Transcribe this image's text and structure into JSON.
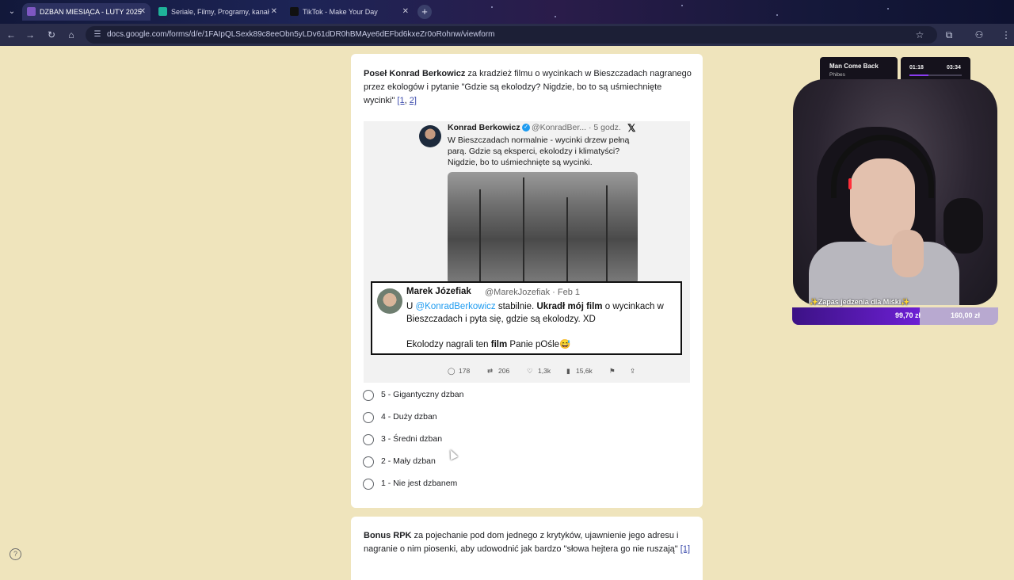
{
  "browser": {
    "tabs": [
      {
        "title": "DZBAN MIESIĄCA - LUTY 2025",
        "active": true
      },
      {
        "title": "Seriale, Filmy, Programy, kanał",
        "active": false
      },
      {
        "title": "TikTok - Make Your Day",
        "active": false
      }
    ],
    "url": "docs.google.com/forms/d/e/1FAIpQLSexk89c8eeObn5yLDv61dDR0hBMAye6dEFbd6kxeZr0oRohnw/viewform"
  },
  "form": {
    "question1": {
      "name": "Poseł Konrad Berkowicz",
      "text": " za kradzież filmu o wycinkach w Bieszczadach nagranego przez ekologów i pytanie \"Gdzie są ekolodzy? Nigdzie, bo to są uśmiechnięte wycinki\" ",
      "links": [
        "[1",
        "2]"
      ]
    },
    "tweet": {
      "author": "Konrad Berkowicz",
      "handle": "@KonradBer... · 5 godz.",
      "text": "W Bieszczadach normalnie - wycinki drzew pełną parą. Gdzie są eksperci, ekolodzy i klimatyści? Nigdzie, bo to uśmiechnięte są wycinki.",
      "quote": {
        "author": "Marek Józefiak",
        "handle": "@MarekJozefiak · Feb 1",
        "text_prefix": "U ",
        "mention": "@KonradBerkowicz",
        "text_mid": " stabilnie. ",
        "text_bold": "Ukradł mój film",
        "text_suffix": " o wycinkach w Bieszczadach i pyta się, gdzie są ekolodzy. XD",
        "line2_prefix": "Ekolodzy nagrali ten ",
        "line2_bold": "film",
        "line2_suffix": " Panie pOśle😅"
      },
      "stats": {
        "replies": "178",
        "retweets": "206",
        "likes": "1,3k",
        "views": "15,6k"
      }
    },
    "options": [
      "5 - Gigantyczny dzban",
      "4 - Duży dzban",
      "3 - Średni dzban",
      "2 - Mały dzban",
      "1 - Nie jest dzbanem"
    ],
    "question2": {
      "name": "Bonus RPK",
      "text": " za pojechanie pod dom jednego z krytyków, ujawnienie jego adresu i nagranie o nim piosenki, aby udowodnić jak bardzo \"słowa hejtera go nie ruszają\" ",
      "link": "[1]"
    }
  },
  "stream": {
    "song_title": "Man Come Back",
    "song_artist": "Phibes",
    "time_current": "01:18",
    "time_total": "03:34",
    "progress": 0.36,
    "goal_text": "✨Zapas jedzenia dla Miśki✨",
    "goal_current": "99,70 zł",
    "goal_target": "160,00 zł",
    "goal_fraction": 0.62
  },
  "colors": {
    "page_bg": "#efe4bc",
    "link": "#3949ab",
    "goal_fill": "#6d1fd4"
  }
}
